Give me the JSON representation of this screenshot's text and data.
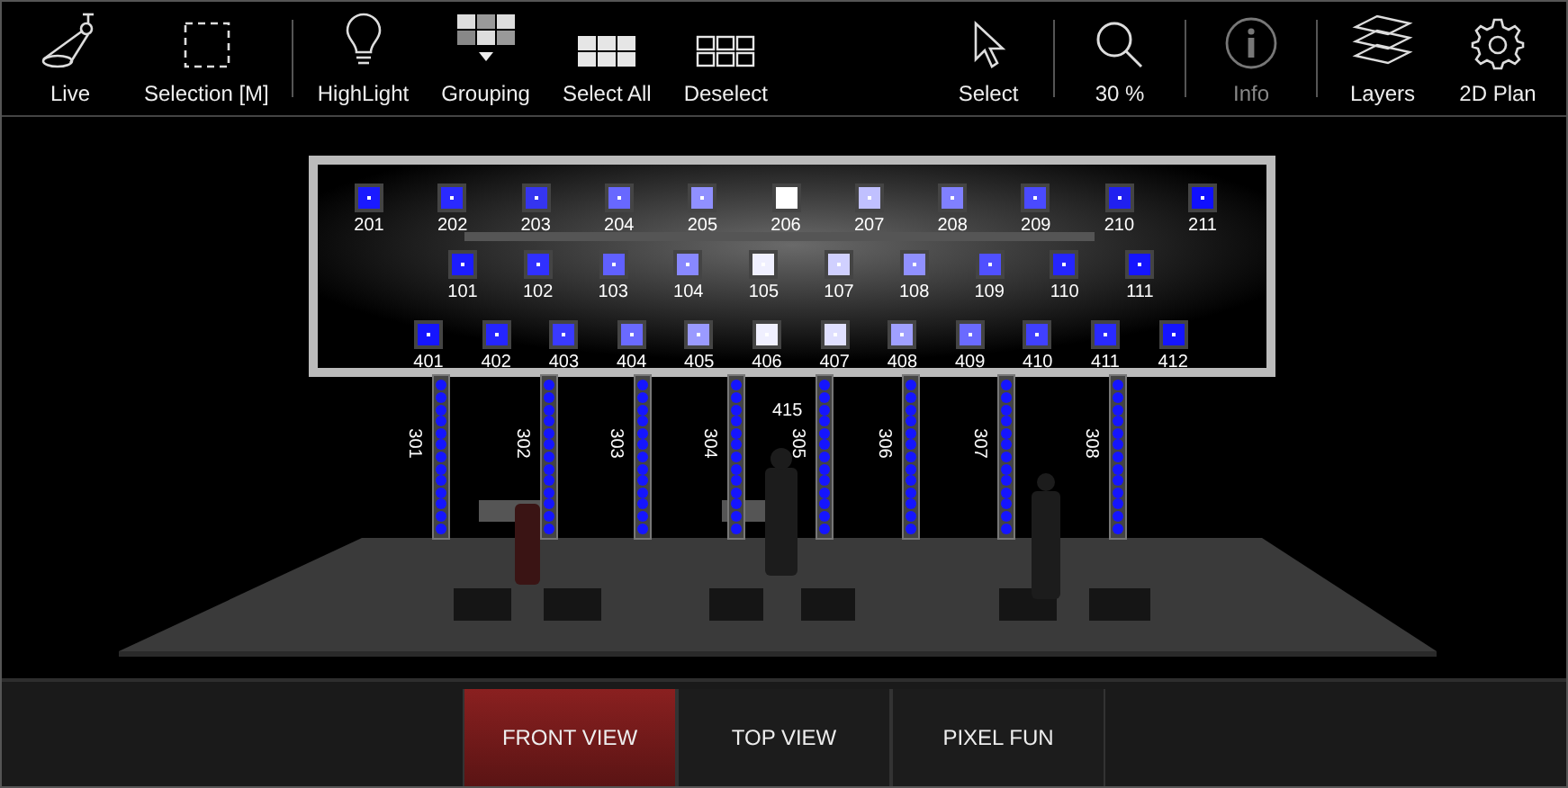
{
  "toolbar": [
    {
      "kind": "live",
      "label": "Live",
      "disabled": false
    },
    {
      "kind": "selection",
      "label": "Selection [M]",
      "disabled": false
    },
    {
      "kind": "separator"
    },
    {
      "kind": "highlight",
      "label": "HighLight",
      "disabled": false
    },
    {
      "kind": "grouping",
      "label": "Grouping",
      "disabled": false
    },
    {
      "kind": "selectall",
      "label": "Select All",
      "disabled": false
    },
    {
      "kind": "deselect",
      "label": "Deselect",
      "disabled": false
    },
    {
      "kind": "spacer"
    },
    {
      "kind": "select",
      "label": "Select",
      "disabled": false
    },
    {
      "kind": "separator"
    },
    {
      "kind": "zoom",
      "label": "30 %",
      "disabled": false
    },
    {
      "kind": "separator"
    },
    {
      "kind": "info",
      "label": "Info",
      "disabled": true
    },
    {
      "kind": "separator"
    },
    {
      "kind": "layers",
      "label": "Layers",
      "disabled": false
    },
    {
      "kind": "plan",
      "label": "2D Plan",
      "disabled": false
    }
  ],
  "fixture_rows": [
    {
      "fixtures": [
        {
          "label": "201",
          "color": "#1a1aff"
        },
        {
          "label": "202",
          "color": "#2a2aff"
        },
        {
          "label": "203",
          "color": "#3535f0"
        },
        {
          "label": "204",
          "color": "#6868ff"
        },
        {
          "label": "205",
          "color": "#9090ff"
        },
        {
          "label": "206",
          "color": "#ffffff"
        },
        {
          "label": "207",
          "color": "#c0c0ff"
        },
        {
          "label": "208",
          "color": "#8080ff"
        },
        {
          "label": "209",
          "color": "#4a4aff"
        },
        {
          "label": "210",
          "color": "#2020f0"
        },
        {
          "label": "211",
          "color": "#1010ff"
        }
      ]
    },
    {
      "fixtures": [
        {
          "label": "101",
          "color": "#1c1cff"
        },
        {
          "label": "102",
          "color": "#3030ff"
        },
        {
          "label": "103",
          "color": "#6060ff"
        },
        {
          "label": "104",
          "color": "#8888ff"
        },
        {
          "label": "105",
          "color": "#f0f0ff"
        },
        {
          "label": "107",
          "color": "#d0d0ff"
        },
        {
          "label": "108",
          "color": "#9090ff"
        },
        {
          "label": "109",
          "color": "#5050ff"
        },
        {
          "label": "110",
          "color": "#2525ff"
        },
        {
          "label": "111",
          "color": "#1515ff"
        }
      ]
    },
    {
      "fixtures": [
        {
          "label": "401",
          "color": "#1515ff"
        },
        {
          "label": "402",
          "color": "#2525ff"
        },
        {
          "label": "403",
          "color": "#3a3aff"
        },
        {
          "label": "404",
          "color": "#6a6aff"
        },
        {
          "label": "405",
          "color": "#9a9aff"
        },
        {
          "label": "406",
          "color": "#f0f0ff"
        },
        {
          "label": "407",
          "color": "#e0e0ff"
        },
        {
          "label": "408",
          "color": "#a0a0ff"
        },
        {
          "label": "409",
          "color": "#6a6aff"
        },
        {
          "label": "410",
          "color": "#4040ff"
        },
        {
          "label": "411",
          "color": "#2a2aff"
        },
        {
          "label": "412",
          "color": "#1515ff"
        }
      ]
    }
  ],
  "led_bars": [
    {
      "label": "301"
    },
    {
      "label": "302"
    },
    {
      "label": "303"
    },
    {
      "label": "304"
    },
    {
      "label": "305"
    },
    {
      "label": "306"
    },
    {
      "label": "307"
    },
    {
      "label": "308"
    }
  ],
  "floating_label": "415",
  "view_tabs": [
    {
      "label": "FRONT VIEW",
      "selected": true
    },
    {
      "label": "TOP VIEW",
      "selected": false
    },
    {
      "label": "PIXEL FUN",
      "selected": false
    }
  ]
}
